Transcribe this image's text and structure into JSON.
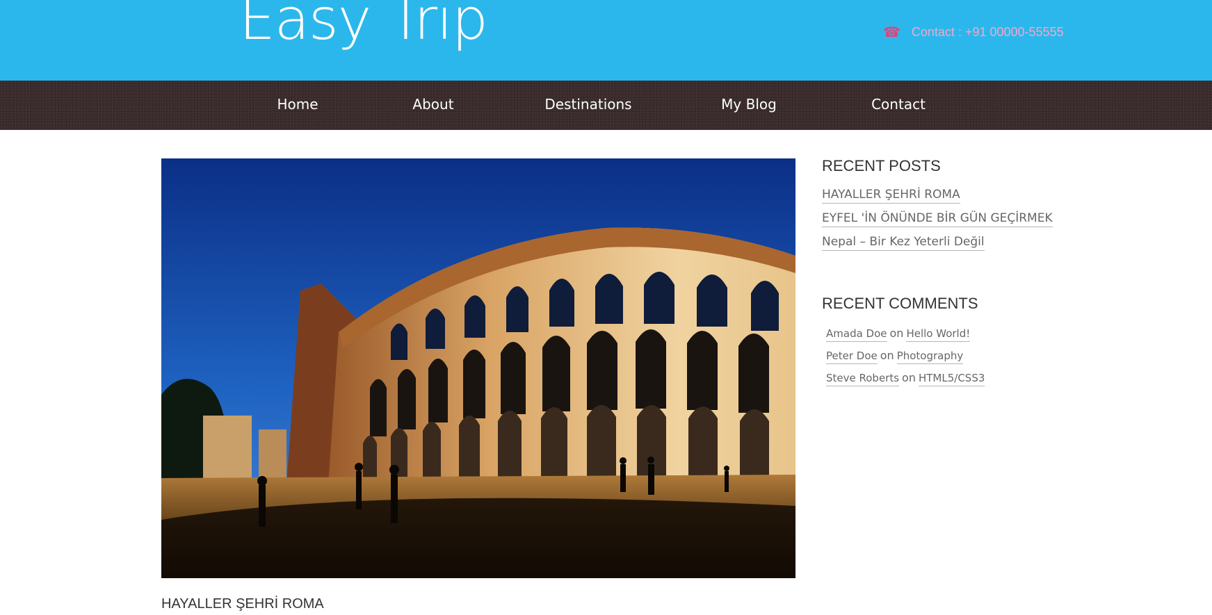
{
  "header": {
    "logo_text": "Easy Trip",
    "contact_icon": "phone-icon",
    "contact_text": "Contact : +91 00000-55555",
    "bg_color": "#2cb7ec"
  },
  "nav": {
    "items": [
      {
        "label": "Home"
      },
      {
        "label": "About"
      },
      {
        "label": "Destinations"
      },
      {
        "label": "My Blog"
      },
      {
        "label": "Contact"
      }
    ]
  },
  "main": {
    "hero_image": "colosseum-photo",
    "post_title": "HAYALLER ŞEHRİ ROMA"
  },
  "sidebar": {
    "recent_posts": {
      "title": "RECENT POSTS",
      "items": [
        {
          "label": "HAYALLER ŞEHRİ ROMA"
        },
        {
          "label": "EYFEL 'İN ÖNÜNDE BİR GÜN GEÇİRMEK"
        },
        {
          "label": "Nepal – Bir Kez Yeterli Değil"
        }
      ]
    },
    "recent_comments": {
      "title": "RECENT COMMENTS",
      "items": [
        {
          "author": "Amada Doe",
          "on": "on",
          "post": "Hello World!"
        },
        {
          "author": "Peter Doe",
          "on": "on",
          "post": "Photography"
        },
        {
          "author": "Steve Roberts",
          "on": "on",
          "post": "HTML5/CSS3"
        }
      ]
    }
  }
}
